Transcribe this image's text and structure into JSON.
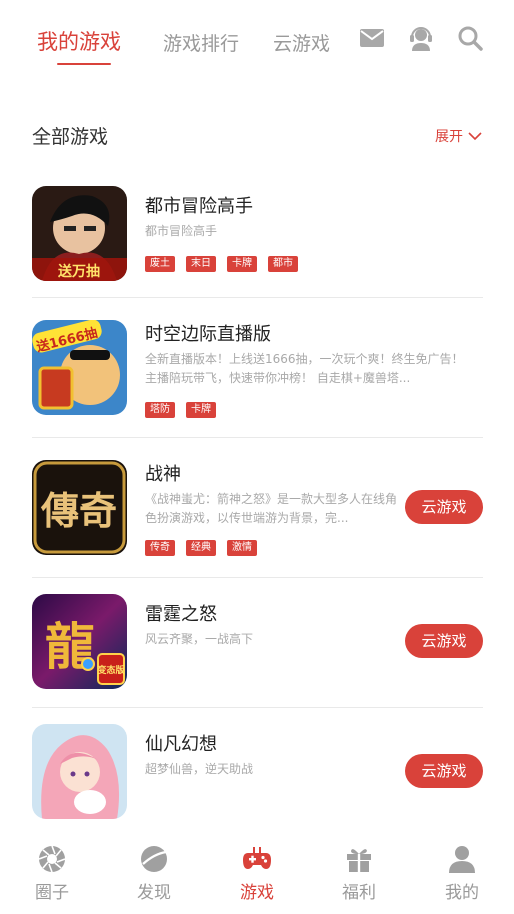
{
  "top_tabs": {
    "my_games": "我的游戏",
    "ranking": "游戏排行",
    "cloud": "云游戏"
  },
  "top_icons": [
    "mail-icon",
    "customer-service-icon",
    "search-icon"
  ],
  "section": {
    "title": "全部游戏",
    "expand_label": "展开"
  },
  "games": [
    {
      "name": "都市冒险高手",
      "desc": "都市冒险高手",
      "tags": [
        "废土",
        "末日",
        "卡牌",
        "都市"
      ],
      "icon_text": "送万抽",
      "cloud_button": ""
    },
    {
      "name": "时空边际直播版",
      "desc": "全新直播版本！上线送1666抽，一次玩个爽！终生免广告！ 主播陪玩带飞，快速带你冲榜！ 自走棋+魔兽塔...",
      "tags": [
        "塔防",
        "卡牌"
      ],
      "icon_text": "送1666抽",
      "cloud_button": ""
    },
    {
      "name": "战神",
      "desc": "《战神蚩尤：箭神之怒》是一款大型多人在线角色扮演游戏，以传世端游为背景，完...",
      "tags": [
        "传奇",
        "经典",
        "激情"
      ],
      "icon_text": "傳奇",
      "cloud_button": "云游戏"
    },
    {
      "name": "雷霆之怒",
      "desc": "风云齐聚，一战高下",
      "tags": [],
      "icon_text": "龍",
      "icon_badge": "变态版",
      "cloud_button": "云游戏"
    },
    {
      "name": "仙凡幻想",
      "desc": "超梦仙兽，逆天助战",
      "tags": [],
      "icon_text": "",
      "cloud_button": "云游戏"
    }
  ],
  "bottom_nav": [
    {
      "label": "圈子",
      "icon": "aperture-icon",
      "active": false
    },
    {
      "label": "发现",
      "icon": "planet-icon",
      "active": false
    },
    {
      "label": "游戏",
      "icon": "gamepad-icon",
      "active": true
    },
    {
      "label": "福利",
      "icon": "gift-icon",
      "active": false
    },
    {
      "label": "我的",
      "icon": "user-icon",
      "active": false
    }
  ],
  "colors": {
    "accent": "#d9423a",
    "muted_text": "#9a9a9a",
    "divider": "#e9e9e9"
  }
}
